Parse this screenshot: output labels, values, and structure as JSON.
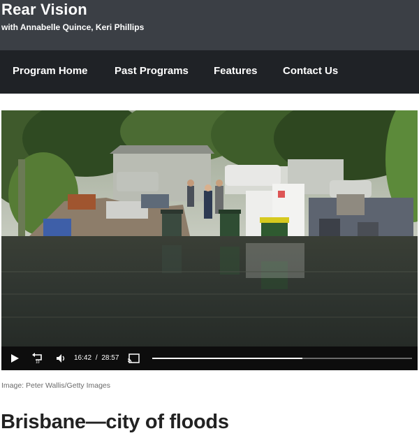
{
  "header": {
    "title": "Rear Vision",
    "hosts": "with Annabelle Quince, Keri Phillips"
  },
  "nav": {
    "items": [
      {
        "label": "Program Home"
      },
      {
        "label": "Past Programs"
      },
      {
        "label": "Features"
      },
      {
        "label": "Contact Us"
      }
    ]
  },
  "player": {
    "current_time": "16:42",
    "separator": "/",
    "duration": "28:57",
    "progress": 0.577,
    "icons": [
      "play-icon",
      "replay-10-icon",
      "volume-icon",
      "cast-icon"
    ]
  },
  "caption": "Image: Peter Wallis/Getty Images",
  "article": {
    "headline": "Brisbane—city of floods"
  }
}
